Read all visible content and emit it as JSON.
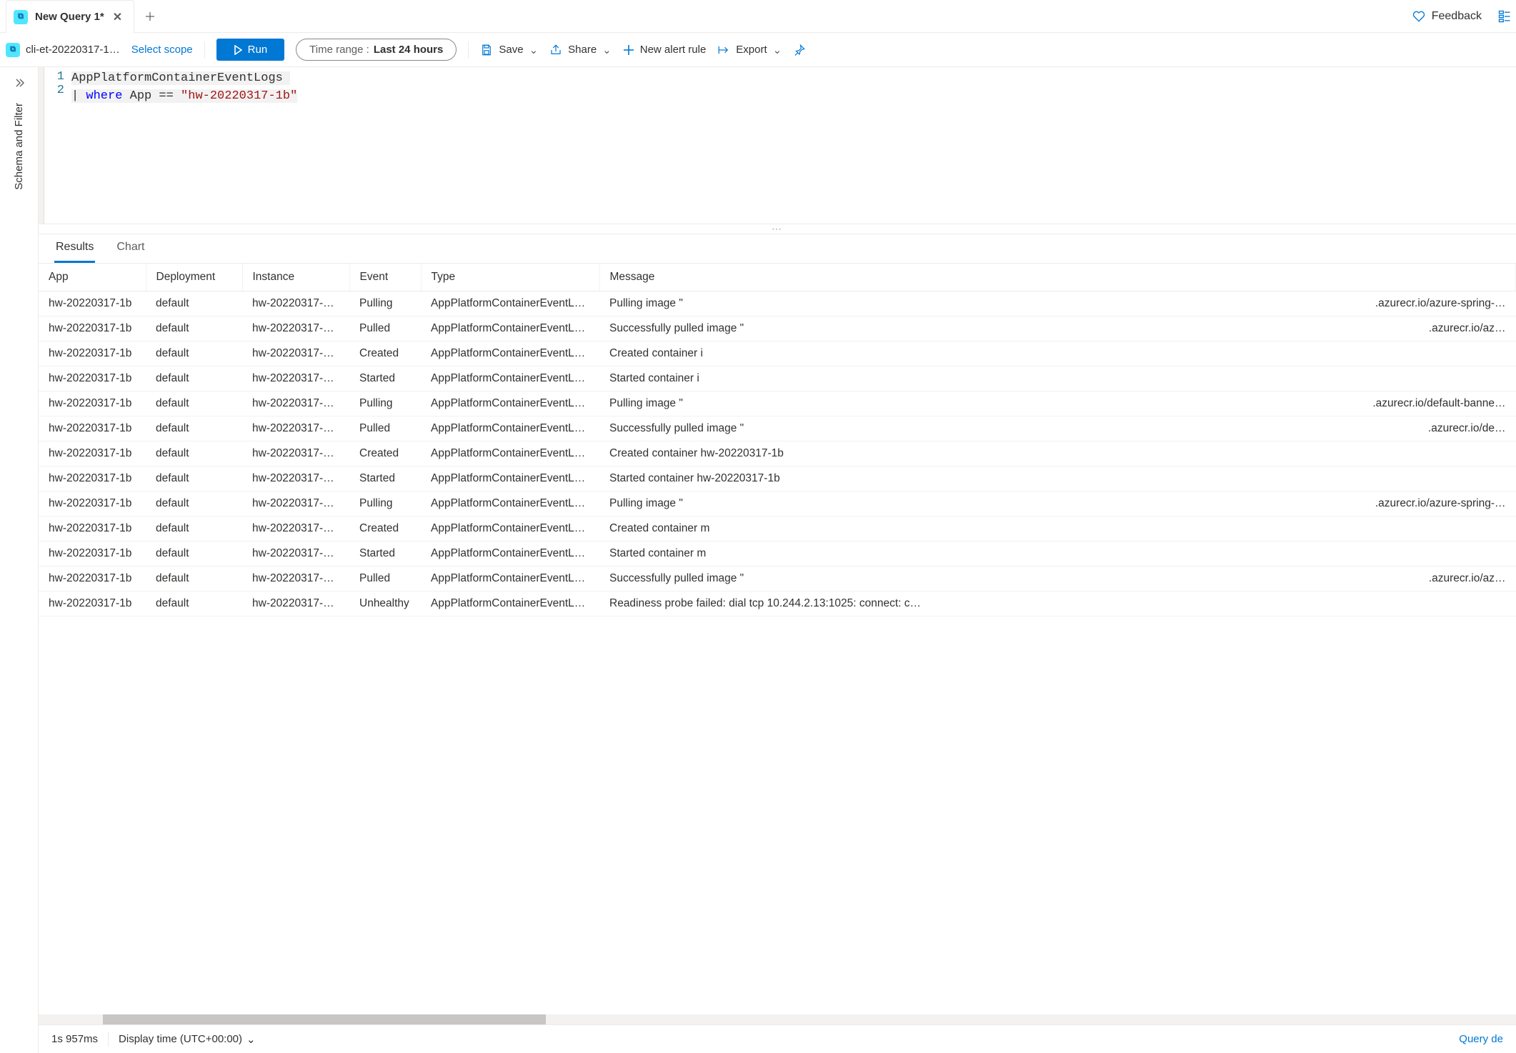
{
  "tabstrip": {
    "tab_title": "New Query 1*",
    "feedback_label": "Feedback"
  },
  "toolbar": {
    "scope_name": "cli-et-20220317-1…",
    "select_scope_label": "Select scope",
    "run_label": "Run",
    "time_range_label": "Time range :",
    "time_range_value": "Last 24 hours",
    "save_label": "Save",
    "share_label": "Share",
    "new_alert_label": "New alert rule",
    "export_label": "Export"
  },
  "leftrail": {
    "panel_label": "Schema and Filter"
  },
  "editor": {
    "line1": "AppPlatformContainerEventLogs",
    "line2_pipe": "| ",
    "line2_kw": "where",
    "line2_mid": " App == ",
    "line2_str": "\"hw-20220317-1b\""
  },
  "result_tabs": {
    "results": "Results",
    "chart": "Chart"
  },
  "table": {
    "columns": [
      "App",
      "Deployment",
      "Instance",
      "Event",
      "Type",
      "Message"
    ],
    "rows": [
      {
        "app": "hw-20220317-1b",
        "deployment": "default",
        "instance": "hw-20220317-1…",
        "event": "Pulling",
        "type": "AppPlatformContainerEventLogs",
        "message": "Pulling image \"",
        "message_extra": ".azurecr.io/azure-spring-…"
      },
      {
        "app": "hw-20220317-1b",
        "deployment": "default",
        "instance": "hw-20220317-1…",
        "event": "Pulled",
        "type": "AppPlatformContainerEventLogs",
        "message": "Successfully pulled image \"",
        "message_extra": ".azurecr.io/az…"
      },
      {
        "app": "hw-20220317-1b",
        "deployment": "default",
        "instance": "hw-20220317-1…",
        "event": "Created",
        "type": "AppPlatformContainerEventLogs",
        "message": "Created container i",
        "message_extra": ""
      },
      {
        "app": "hw-20220317-1b",
        "deployment": "default",
        "instance": "hw-20220317-1…",
        "event": "Started",
        "type": "AppPlatformContainerEventLogs",
        "message": "Started container i",
        "message_extra": ""
      },
      {
        "app": "hw-20220317-1b",
        "deployment": "default",
        "instance": "hw-20220317-1…",
        "event": "Pulling",
        "type": "AppPlatformContainerEventLogs",
        "message": "Pulling image \"",
        "message_extra": ".azurecr.io/default-banne…"
      },
      {
        "app": "hw-20220317-1b",
        "deployment": "default",
        "instance": "hw-20220317-1…",
        "event": "Pulled",
        "type": "AppPlatformContainerEventLogs",
        "message": "Successfully pulled image \"",
        "message_extra": ".azurecr.io/de…"
      },
      {
        "app": "hw-20220317-1b",
        "deployment": "default",
        "instance": "hw-20220317-1…",
        "event": "Created",
        "type": "AppPlatformContainerEventLogs",
        "message": "Created container hw-20220317-1b",
        "message_extra": ""
      },
      {
        "app": "hw-20220317-1b",
        "deployment": "default",
        "instance": "hw-20220317-1…",
        "event": "Started",
        "type": "AppPlatformContainerEventLogs",
        "message": "Started container hw-20220317-1b",
        "message_extra": ""
      },
      {
        "app": "hw-20220317-1b",
        "deployment": "default",
        "instance": "hw-20220317-1…",
        "event": "Pulling",
        "type": "AppPlatformContainerEventLogs",
        "message": "Pulling image \"",
        "message_extra": ".azurecr.io/azure-spring-…"
      },
      {
        "app": "hw-20220317-1b",
        "deployment": "default",
        "instance": "hw-20220317-1…",
        "event": "Created",
        "type": "AppPlatformContainerEventLogs",
        "message": "Created container m",
        "message_extra": ""
      },
      {
        "app": "hw-20220317-1b",
        "deployment": "default",
        "instance": "hw-20220317-1…",
        "event": "Started",
        "type": "AppPlatformContainerEventLogs",
        "message": "Started container m",
        "message_extra": ""
      },
      {
        "app": "hw-20220317-1b",
        "deployment": "default",
        "instance": "hw-20220317-1…",
        "event": "Pulled",
        "type": "AppPlatformContainerEventLogs",
        "message": "Successfully pulled image \"",
        "message_extra": ".azurecr.io/az…"
      },
      {
        "app": "hw-20220317-1b",
        "deployment": "default",
        "instance": "hw-20220317-1…",
        "event": "Unhealthy",
        "type": "AppPlatformContainerEventLogs",
        "message": "Readiness probe failed: dial tcp 10.244.2.13:1025: connect: c…",
        "message_extra": ""
      }
    ]
  },
  "statusbar": {
    "elapsed": "1s 957ms",
    "display_time": "Display time (UTC+00:00)",
    "query_details": "Query de"
  }
}
